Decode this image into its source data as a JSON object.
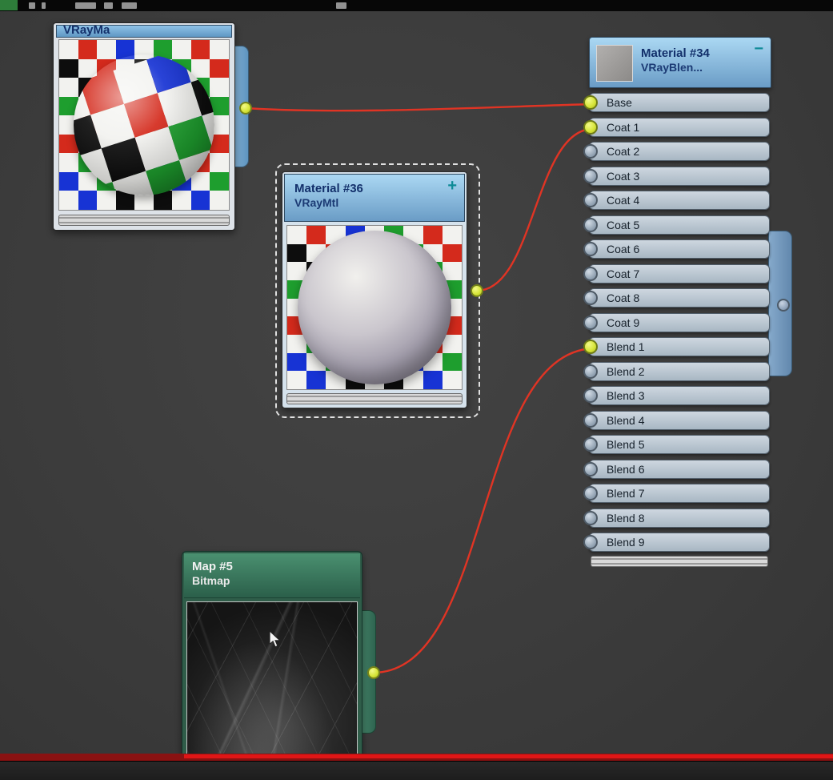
{
  "nodes": {
    "vraymtl_top": {
      "title_visible": "VRayMa"
    },
    "material36": {
      "title": "Material #36",
      "subtitle": "VRayMtl",
      "expand_icon": "+"
    },
    "material34": {
      "title": "Material #34",
      "subtitle": "VRayBlen...",
      "collapse_icon": "−",
      "slots": [
        {
          "label": "Base",
          "connected": true
        },
        {
          "label": "Coat 1",
          "connected": true
        },
        {
          "label": "Coat 2",
          "connected": false
        },
        {
          "label": "Coat 3",
          "connected": false
        },
        {
          "label": "Coat 4",
          "connected": false
        },
        {
          "label": "Coat 5",
          "connected": false
        },
        {
          "label": "Coat 6",
          "connected": false
        },
        {
          "label": "Coat 7",
          "connected": false
        },
        {
          "label": "Coat 8",
          "connected": false
        },
        {
          "label": "Coat 9",
          "connected": false
        },
        {
          "label": "Blend 1",
          "connected": true
        },
        {
          "label": "Blend 2",
          "connected": false
        },
        {
          "label": "Blend 3",
          "connected": false
        },
        {
          "label": "Blend 4",
          "connected": false
        },
        {
          "label": "Blend 5",
          "connected": false
        },
        {
          "label": "Blend 6",
          "connected": false
        },
        {
          "label": "Blend 7",
          "connected": false
        },
        {
          "label": "Blend 8",
          "connected": false
        },
        {
          "label": "Blend 9",
          "connected": false
        }
      ]
    },
    "map5": {
      "title": "Map #5",
      "subtitle": "Bitmap"
    }
  },
  "connections": [
    {
      "from": "vraymtl_top",
      "to": "Base"
    },
    {
      "from": "material36",
      "to": "Coat 1"
    },
    {
      "from": "map5",
      "to": "Blend 1"
    }
  ],
  "colors": {
    "wire": "#e03424",
    "connector_active": "#d8e63c",
    "connector_idle": "#9fb0bf",
    "red_bar": "#e01616"
  }
}
